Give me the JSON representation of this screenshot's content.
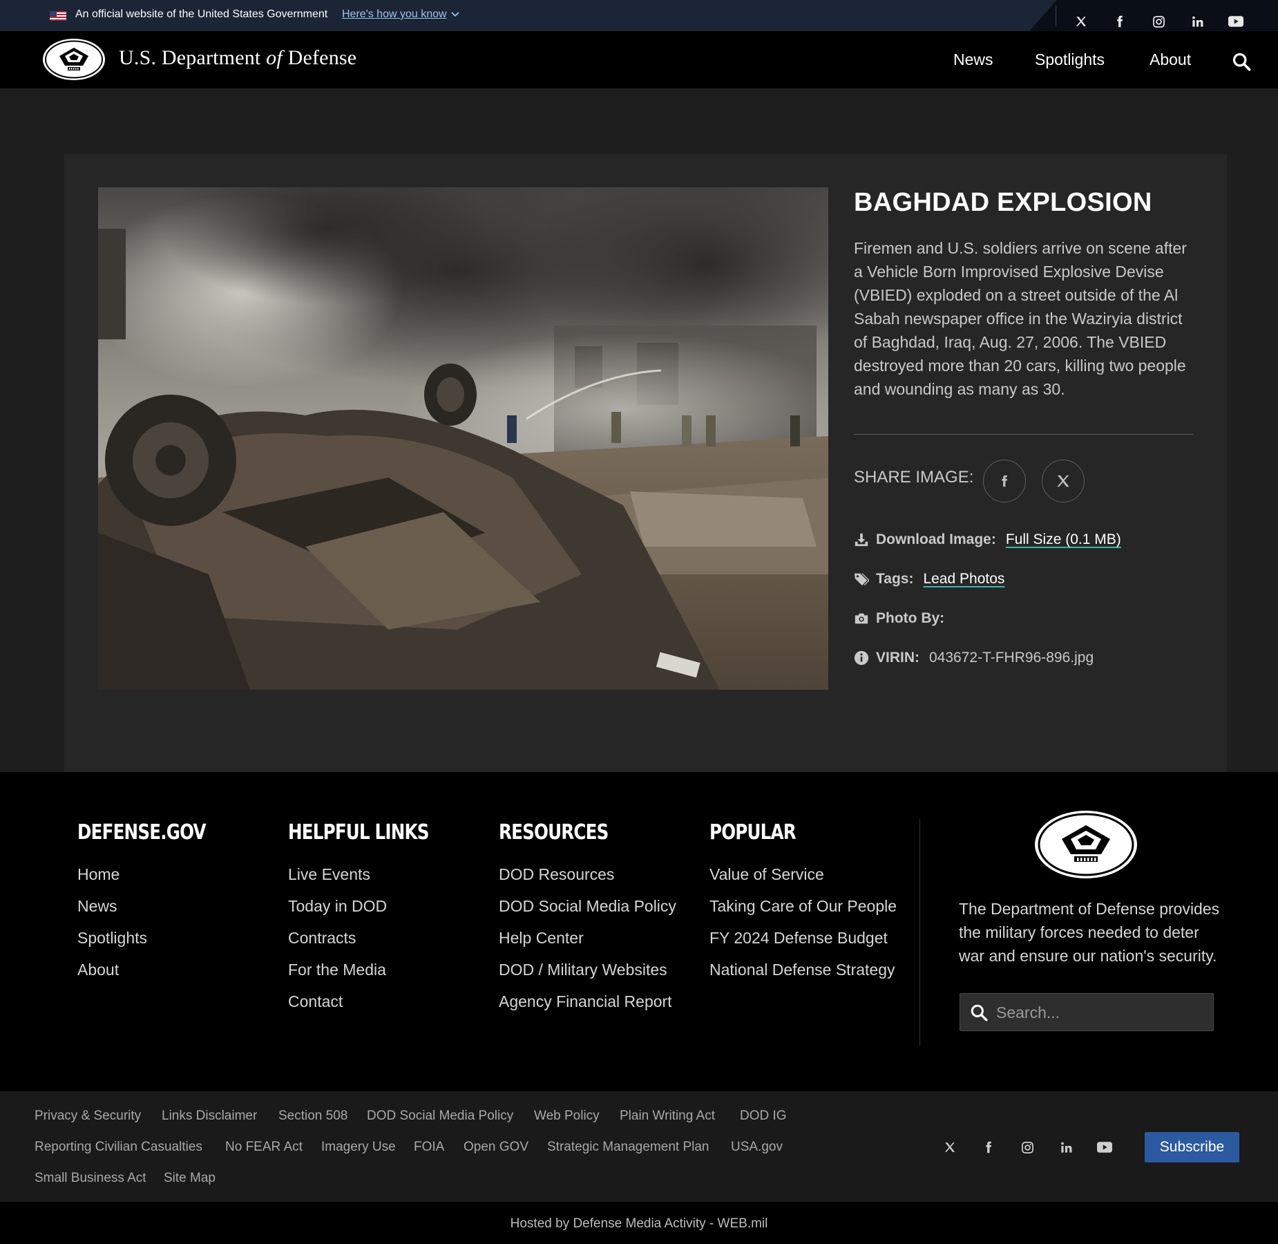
{
  "gov_banner": {
    "official_text": "An official website of the United States Government",
    "how_you_know": "Here's how you know"
  },
  "header": {
    "title_pre": "U.S. Department ",
    "title_of": "of",
    "title_post": " Defense",
    "nav": [
      "News",
      "Spotlights",
      "About"
    ]
  },
  "image": {
    "title": "BAGHDAD EXPLOSION",
    "caption": "Firemen and U.S. soldiers arrive on scene after a Vehicle Born Improvised Explosive Devise (VBIED) exploded on a street outside of the Al Sabah newspaper office in the Waziryia district of Baghdad, Iraq, Aug. 27, 2006. The VBIED destroyed more than 20 cars, killing two people and wounding as many as 30.",
    "share_label": "SHARE IMAGE:",
    "download_label": "Download Image:",
    "download_link": "Full Size (0.1 MB)",
    "tags_label": "Tags:",
    "tags_link": "Lead Photos",
    "photo_by_label": "Photo By:",
    "virin_label": "VIRIN:",
    "virin_value": "043672-T-FHR96-896.jpg"
  },
  "footer": {
    "columns": [
      {
        "heading": "DEFENSE.GOV",
        "links": [
          "Home",
          "News",
          "Spotlights",
          "About"
        ]
      },
      {
        "heading": "HELPFUL LINKS",
        "links": [
          "Live Events",
          "Today in DOD",
          "Contracts",
          "For the Media",
          "Contact"
        ]
      },
      {
        "heading": "RESOURCES",
        "links": [
          "DOD Resources",
          "DOD Social Media Policy",
          "Help Center",
          "DOD / Military Websites",
          "Agency Financial Report"
        ]
      },
      {
        "heading": "POPULAR",
        "links": [
          "Value of Service",
          "Taking Care of Our People",
          "FY 2024 Defense Budget",
          "National Defense Strategy"
        ]
      }
    ],
    "about_text": "The Department of Defense provides the military forces needed to deter war and ensure our nation's security.",
    "search_placeholder": "Search..."
  },
  "legal": {
    "row1": [
      "Privacy & Security",
      "Links Disclaimer",
      "Section 508",
      "DOD Social Media Policy",
      "Web Policy",
      "Plain Writing Act",
      "DOD IG"
    ],
    "row2": [
      "Reporting Civilian Casualties",
      "No FEAR Act",
      "Imagery Use",
      "FOIA",
      "Open GOV",
      "Strategic Management Plan",
      "USA.gov"
    ],
    "row3": [
      "Small Business Act",
      "Site Map"
    ],
    "subscribe": "Subscribe"
  },
  "hosted": "Hosted by Defense Media Activity - WEB.mil",
  "icons": [
    "x-icon",
    "facebook-icon",
    "instagram-icon",
    "linkedin-icon",
    "youtube-icon",
    "search-icon",
    "download-icon",
    "tag-icon",
    "camera-icon",
    "info-icon"
  ],
  "colors": {
    "accent_underline": "#3fb6a8",
    "subscribe": "#2c5aa0",
    "banner": "#1b2535"
  }
}
